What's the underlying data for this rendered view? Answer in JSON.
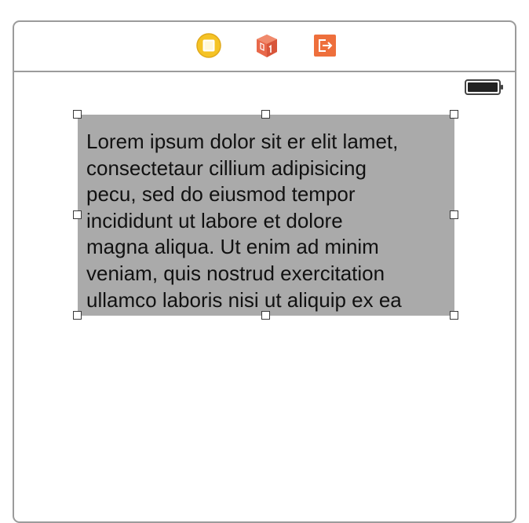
{
  "scene": {
    "dock_icons": [
      "view-controller-icon",
      "first-responder-icon",
      "exit-icon"
    ],
    "status_bar": {
      "battery_icon": "battery-icon"
    },
    "text_view": {
      "text": "Lorem ipsum dolor sit er elit lamet,\nconsectetaur cillium adipisicing\npecu, sed do eiusmod tempor\nincididunt ut labore et dolore\nmagna aliqua. Ut enim ad minim\nveniam, quis nostrud exercitation\nullamco laboris nisi ut aliquip ex ea",
      "background_color": "#aaaaaa",
      "selected": true
    }
  },
  "colors": {
    "view_controller_icon": "#f5c325",
    "first_responder_icon": "#e8684a",
    "exit_icon": "#ee6f3c",
    "border": "#9b9b9b"
  }
}
